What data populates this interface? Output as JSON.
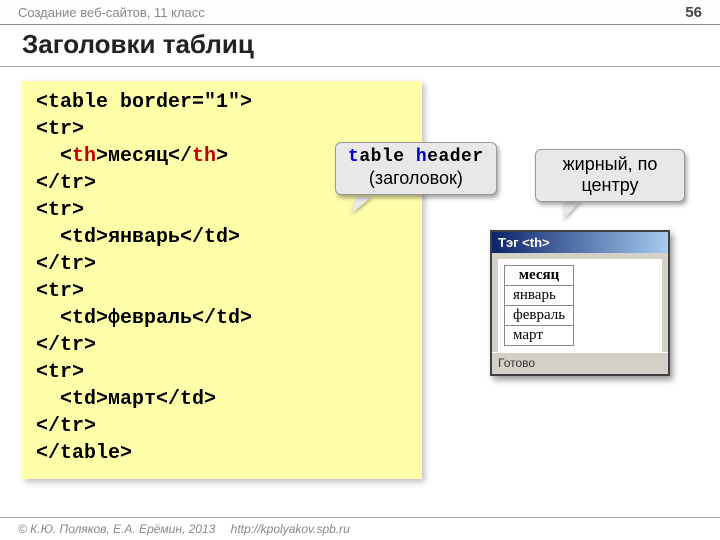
{
  "header": {
    "course": "Создание веб-сайтов, 11 класс",
    "page_number": "56"
  },
  "title": "Заголовки таблиц",
  "code": {
    "l1a": "<table border=\"1\">",
    "l2": "<tr>",
    "l3a": "  <",
    "l3b": "th",
    "l3c": ">месяц</",
    "l3d": "th",
    "l3e": ">",
    "l4": "</tr>",
    "l5": "<tr>",
    "l6": "  <td>январь</td>",
    "l7": "</tr>",
    "l8": "<tr>",
    "l9": "  <td>февраль</td>",
    "l10": "</tr>",
    "l11": "<tr>",
    "l12": "  <td>март</td>",
    "l13": "</tr>",
    "l14": "</table>"
  },
  "callouts": {
    "th_mono_t": "t",
    "th_mono_rest1": "able ",
    "th_mono_h": "h",
    "th_mono_rest2": "eader",
    "th_sub": "(заголовок)",
    "bold_center": "жирный, по центру"
  },
  "browser": {
    "title": "Тэг <th>",
    "status": "Готово",
    "table": {
      "header": "месяц",
      "rows": [
        "январь",
        "февраль",
        "март"
      ]
    }
  },
  "footer": {
    "copyright": "© К.Ю. Поляков, Е.А. Ерёмин, 2013",
    "url": "http://kpolyakov.spb.ru"
  }
}
